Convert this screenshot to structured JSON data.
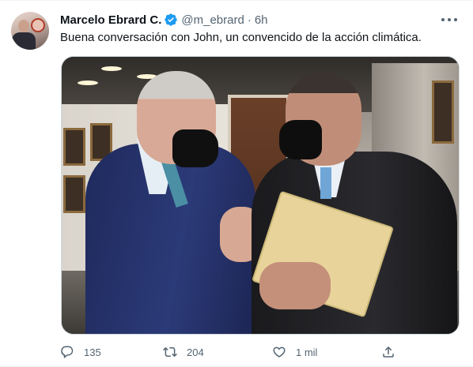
{
  "tweet": {
    "author_name": "Marcelo Ebrard C.",
    "handle": "@m_ebrard",
    "separator": "·",
    "time": "6h",
    "text": "Buena conversación con John, un convencido de la acción climática.",
    "verified_icon": "verified-badge-icon",
    "more_icon": "more-options-icon"
  },
  "media": {
    "icon": "tweet-photo"
  },
  "actions": {
    "reply_count": "135",
    "retweet_count": "204",
    "like_count": "1 mil",
    "reply_icon": "reply-icon",
    "retweet_icon": "retweet-icon",
    "like_icon": "like-icon",
    "share_icon": "share-icon"
  },
  "colors": {
    "accent": "#1d9bf0",
    "text_primary": "#0f1419",
    "text_secondary": "#536471",
    "border": "#cfd9de"
  }
}
